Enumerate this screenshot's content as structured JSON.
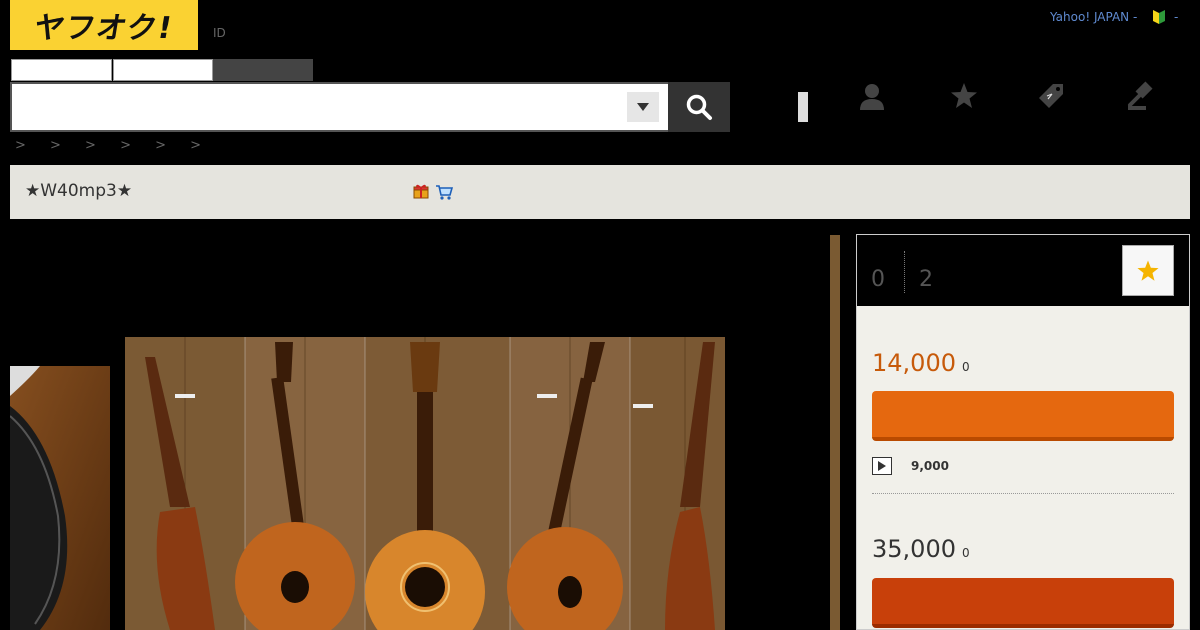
{
  "header": {
    "logo_text": "ヤフオク!",
    "id_label": "ID",
    "yahoo_japan_label": "Yahoo! JAPAN -",
    "trailing_dash": "-"
  },
  "search": {
    "value": "",
    "placeholder": ""
  },
  "breadcrumb": {
    "text": "> > > > > >"
  },
  "item": {
    "title": "★W40mp3★"
  },
  "panel": {
    "bid_count": "0",
    "watch_count": "2",
    "current_price": "14,000",
    "current_price_suffix": "0",
    "start_price": "9,000",
    "buynow_price": "35,000",
    "buynow_price_suffix": "0"
  },
  "colors": {
    "logo_yellow": "#fad232",
    "bid_orange": "#e5680f",
    "buynow_red": "#c8400a",
    "price_orange": "#c75a0a",
    "yahoo_link_blue": "#5f8ad0",
    "title_bar_bg": "#e5e4de"
  }
}
